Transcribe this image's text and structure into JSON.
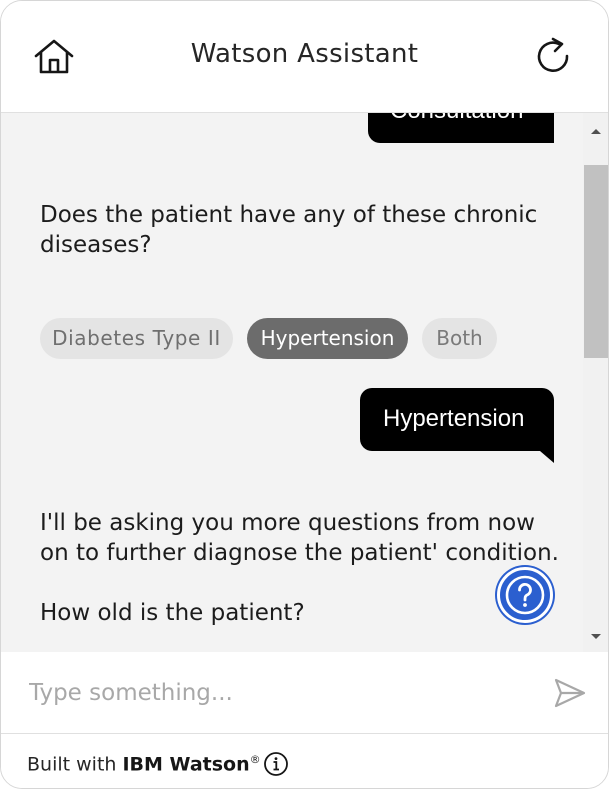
{
  "header": {
    "title": "Watson Assistant",
    "home_icon": "home-icon",
    "restart_icon": "restart-icon"
  },
  "conversation": {
    "user_messages": [
      {
        "text": "Consultation"
      },
      {
        "text": "Hypertension"
      }
    ],
    "bot_messages": [
      {
        "text": "Does the patient have any of these chronic diseases?"
      },
      {
        "text": "I'll be asking you more questions from now on to further diagnose the patient' condition."
      },
      {
        "text": "How old is the patient?"
      }
    ],
    "options": [
      {
        "label": "Diabetes Type II",
        "selected": false
      },
      {
        "label": "Hypertension",
        "selected": true
      },
      {
        "label": "Both",
        "selected": false
      }
    ]
  },
  "help": {
    "icon": "question-mark-icon"
  },
  "input": {
    "placeholder": "Type something...",
    "value": "",
    "send_icon": "send-icon"
  },
  "footer": {
    "built_with": "Built with",
    "brand": "IBM Watson",
    "trademark": "®",
    "info_icon": "info-icon"
  },
  "colors": {
    "conversation_bg": "#f3f3f3",
    "user_bubble": "#000000",
    "selected_chip": "#6c6c6c",
    "help_button": "#2b5fcf"
  }
}
